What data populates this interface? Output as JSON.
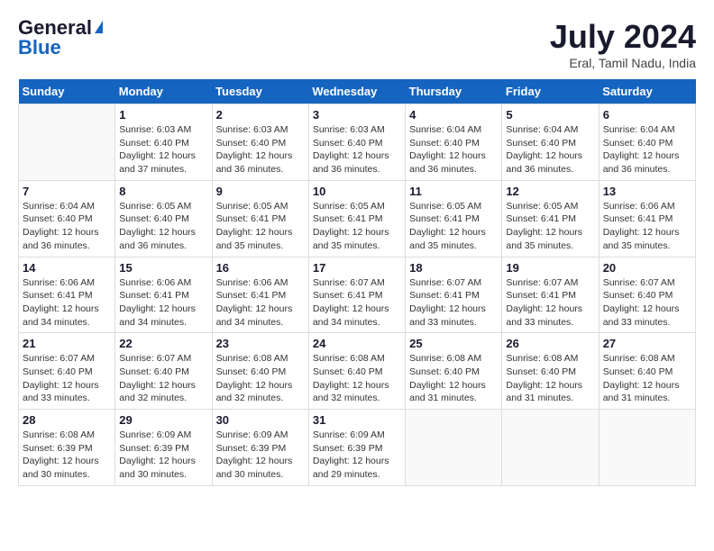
{
  "header": {
    "logo_general": "General",
    "logo_blue": "Blue",
    "month_year": "July 2024",
    "location": "Eral, Tamil Nadu, India"
  },
  "calendar": {
    "days_of_week": [
      "Sunday",
      "Monday",
      "Tuesday",
      "Wednesday",
      "Thursday",
      "Friday",
      "Saturday"
    ],
    "weeks": [
      [
        {
          "day": "",
          "empty": true
        },
        {
          "day": "1",
          "sunrise": "6:03 AM",
          "sunset": "6:40 PM",
          "daylight": "12 hours and 37 minutes."
        },
        {
          "day": "2",
          "sunrise": "6:03 AM",
          "sunset": "6:40 PM",
          "daylight": "12 hours and 36 minutes."
        },
        {
          "day": "3",
          "sunrise": "6:03 AM",
          "sunset": "6:40 PM",
          "daylight": "12 hours and 36 minutes."
        },
        {
          "day": "4",
          "sunrise": "6:04 AM",
          "sunset": "6:40 PM",
          "daylight": "12 hours and 36 minutes."
        },
        {
          "day": "5",
          "sunrise": "6:04 AM",
          "sunset": "6:40 PM",
          "daylight": "12 hours and 36 minutes."
        },
        {
          "day": "6",
          "sunrise": "6:04 AM",
          "sunset": "6:40 PM",
          "daylight": "12 hours and 36 minutes."
        }
      ],
      [
        {
          "day": "7",
          "sunrise": "6:04 AM",
          "sunset": "6:40 PM",
          "daylight": "12 hours and 36 minutes."
        },
        {
          "day": "8",
          "sunrise": "6:05 AM",
          "sunset": "6:40 PM",
          "daylight": "12 hours and 36 minutes."
        },
        {
          "day": "9",
          "sunrise": "6:05 AM",
          "sunset": "6:41 PM",
          "daylight": "12 hours and 35 minutes."
        },
        {
          "day": "10",
          "sunrise": "6:05 AM",
          "sunset": "6:41 PM",
          "daylight": "12 hours and 35 minutes."
        },
        {
          "day": "11",
          "sunrise": "6:05 AM",
          "sunset": "6:41 PM",
          "daylight": "12 hours and 35 minutes."
        },
        {
          "day": "12",
          "sunrise": "6:05 AM",
          "sunset": "6:41 PM",
          "daylight": "12 hours and 35 minutes."
        },
        {
          "day": "13",
          "sunrise": "6:06 AM",
          "sunset": "6:41 PM",
          "daylight": "12 hours and 35 minutes."
        }
      ],
      [
        {
          "day": "14",
          "sunrise": "6:06 AM",
          "sunset": "6:41 PM",
          "daylight": "12 hours and 34 minutes."
        },
        {
          "day": "15",
          "sunrise": "6:06 AM",
          "sunset": "6:41 PM",
          "daylight": "12 hours and 34 minutes."
        },
        {
          "day": "16",
          "sunrise": "6:06 AM",
          "sunset": "6:41 PM",
          "daylight": "12 hours and 34 minutes."
        },
        {
          "day": "17",
          "sunrise": "6:07 AM",
          "sunset": "6:41 PM",
          "daylight": "12 hours and 34 minutes."
        },
        {
          "day": "18",
          "sunrise": "6:07 AM",
          "sunset": "6:41 PM",
          "daylight": "12 hours and 33 minutes."
        },
        {
          "day": "19",
          "sunrise": "6:07 AM",
          "sunset": "6:41 PM",
          "daylight": "12 hours and 33 minutes."
        },
        {
          "day": "20",
          "sunrise": "6:07 AM",
          "sunset": "6:40 PM",
          "daylight": "12 hours and 33 minutes."
        }
      ],
      [
        {
          "day": "21",
          "sunrise": "6:07 AM",
          "sunset": "6:40 PM",
          "daylight": "12 hours and 33 minutes."
        },
        {
          "day": "22",
          "sunrise": "6:07 AM",
          "sunset": "6:40 PM",
          "daylight": "12 hours and 32 minutes."
        },
        {
          "day": "23",
          "sunrise": "6:08 AM",
          "sunset": "6:40 PM",
          "daylight": "12 hours and 32 minutes."
        },
        {
          "day": "24",
          "sunrise": "6:08 AM",
          "sunset": "6:40 PM",
          "daylight": "12 hours and 32 minutes."
        },
        {
          "day": "25",
          "sunrise": "6:08 AM",
          "sunset": "6:40 PM",
          "daylight": "12 hours and 31 minutes."
        },
        {
          "day": "26",
          "sunrise": "6:08 AM",
          "sunset": "6:40 PM",
          "daylight": "12 hours and 31 minutes."
        },
        {
          "day": "27",
          "sunrise": "6:08 AM",
          "sunset": "6:40 PM",
          "daylight": "12 hours and 31 minutes."
        }
      ],
      [
        {
          "day": "28",
          "sunrise": "6:08 AM",
          "sunset": "6:39 PM",
          "daylight": "12 hours and 30 minutes."
        },
        {
          "day": "29",
          "sunrise": "6:09 AM",
          "sunset": "6:39 PM",
          "daylight": "12 hours and 30 minutes."
        },
        {
          "day": "30",
          "sunrise": "6:09 AM",
          "sunset": "6:39 PM",
          "daylight": "12 hours and 30 minutes."
        },
        {
          "day": "31",
          "sunrise": "6:09 AM",
          "sunset": "6:39 PM",
          "daylight": "12 hours and 29 minutes."
        },
        {
          "day": "",
          "empty": true
        },
        {
          "day": "",
          "empty": true
        },
        {
          "day": "",
          "empty": true
        }
      ]
    ]
  }
}
